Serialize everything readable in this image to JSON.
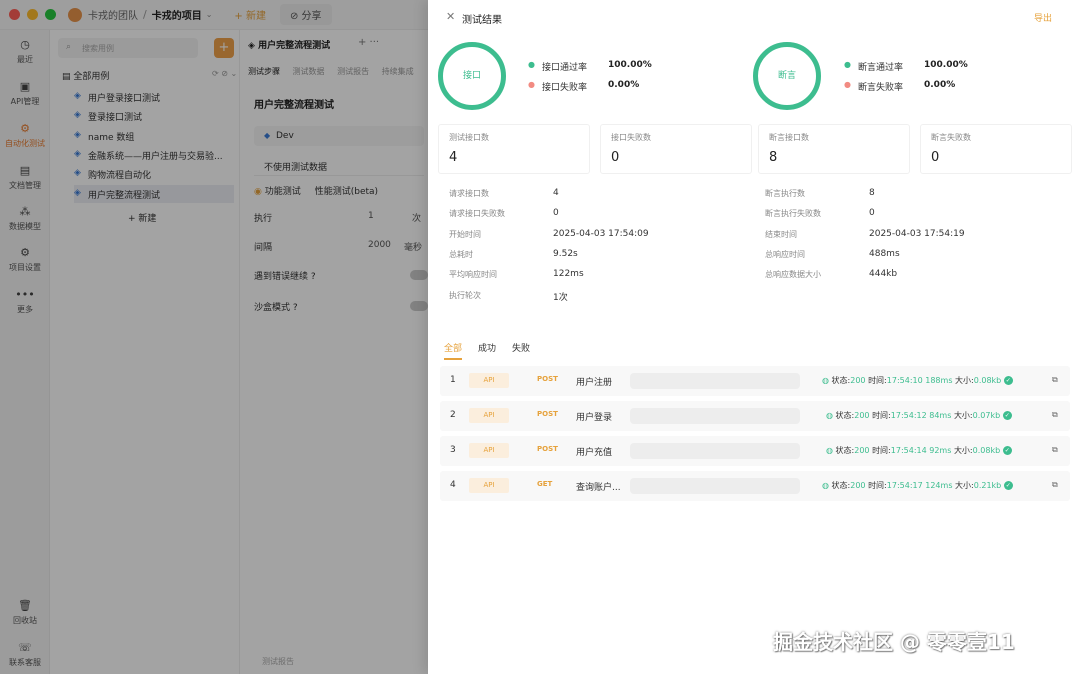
{
  "titlebar": {
    "team": "卡戎的团队",
    "project": "卡戎的项目",
    "new_label": "+ 新建",
    "share_label": "分享"
  },
  "sidebar": {
    "items": [
      {
        "label": "最近",
        "icon": "clock-icon",
        "glyph": "◷"
      },
      {
        "label": "API管理",
        "icon": "api-icon",
        "glyph": "▣"
      },
      {
        "label": "自动化测试",
        "icon": "automation-icon",
        "glyph": "⚙"
      },
      {
        "label": "文档管理",
        "icon": "document-icon",
        "glyph": "▤"
      },
      {
        "label": "数据模型",
        "icon": "data-model-icon",
        "glyph": "⁂"
      },
      {
        "label": "项目设置",
        "icon": "settings-icon",
        "glyph": "⚙"
      },
      {
        "label": "更多",
        "icon": "more-icon",
        "glyph": "•••"
      }
    ],
    "bottom": [
      {
        "label": "回收站",
        "icon": "trash-icon",
        "glyph": "🗑"
      },
      {
        "label": "联系客服",
        "icon": "support-icon",
        "glyph": "☏"
      }
    ]
  },
  "tree": {
    "search_placeholder": "搜索用例",
    "add": "+",
    "header": "全部用例",
    "items": [
      "用户登录接口测试",
      "登录接口测试",
      "name 数组",
      "金融系统——用户注册与交易验...",
      "购物流程自动化",
      "用户完整流程测试"
    ],
    "new_label": "+ 新建"
  },
  "center": {
    "tab_title": "用户完整流程测试",
    "tab_ctrl": "+  ···",
    "subtabs": [
      "测试步骤",
      "测试数据",
      "测试报告",
      "持续集成"
    ],
    "heading": "用户完整流程测试",
    "env": "Dev",
    "data_mode": "不使用测试数据",
    "mode1": "功能测试",
    "mode2": "性能测试(beta)",
    "rows": [
      {
        "label": "执行",
        "value": "1",
        "unit": "次"
      },
      {
        "label": "间隔",
        "value": "2000",
        "unit": "毫秒"
      }
    ],
    "toggle1": "遇到错误继续",
    "toggle2": "沙盒模式",
    "report": "测试报告"
  },
  "drawer": {
    "title": "测试结果",
    "export": "导出",
    "api_ring": "接口",
    "assert_ring": "断言",
    "api_pass_label": "接口通过率",
    "api_pass_value": "100.00%",
    "api_fail_label": "接口失败率",
    "api_fail_value": "0.00%",
    "assert_pass_label": "断言通过率",
    "assert_pass_value": "100.00%",
    "assert_fail_label": "断言失败率",
    "assert_fail_value": "0.00%",
    "cards": [
      {
        "label": "测试接口数",
        "value": "4"
      },
      {
        "label": "接口失败数",
        "value": "0"
      },
      {
        "label": "断言接口数",
        "value": "8"
      },
      {
        "label": "断言失败数",
        "value": "0"
      }
    ],
    "left_kv": [
      {
        "k": "请求接口数",
        "v": "4"
      },
      {
        "k": "请求接口失败数",
        "v": "0"
      },
      {
        "k": "开始时间",
        "v": "2025-04-03 17:54:09"
      },
      {
        "k": "总耗时",
        "v": "9.52s"
      },
      {
        "k": "平均响应时间",
        "v": "122ms"
      },
      {
        "k": "执行轮次",
        "v": "1次"
      }
    ],
    "right_kv": [
      {
        "k": "断言执行数",
        "v": "8"
      },
      {
        "k": "断言执行失败数",
        "v": "0"
      },
      {
        "k": "结束时间",
        "v": "2025-04-03 17:54:19"
      },
      {
        "k": "总响应时间",
        "v": "488ms"
      },
      {
        "k": "总响应数据大小",
        "v": "444kb"
      }
    ],
    "tabs": [
      "全部",
      "成功",
      "失败"
    ],
    "requests": [
      {
        "num": "1",
        "tag": "API",
        "method": "POST",
        "name": "用户注册",
        "status_label": "状态:",
        "status": "200",
        "time_label": "时间:",
        "time": "17:54:10",
        "ms": "188ms",
        "size_label": "大小:",
        "size": "0.08kb"
      },
      {
        "num": "2",
        "tag": "API",
        "method": "POST",
        "name": "用户登录",
        "status_label": "状态:",
        "status": "200",
        "time_label": "时间:",
        "time": "17:54:12",
        "ms": "84ms",
        "size_label": "大小:",
        "size": "0.07kb"
      },
      {
        "num": "3",
        "tag": "API",
        "method": "POST",
        "name": "用户充值",
        "status_label": "状态:",
        "status": "200",
        "time_label": "时间:",
        "time": "17:54:14",
        "ms": "92ms",
        "size_label": "大小:",
        "size": "0.08kb"
      },
      {
        "num": "4",
        "tag": "API",
        "method": "GET",
        "name": "查询账户...",
        "status_label": "状态:",
        "status": "200",
        "time_label": "时间:",
        "time": "17:54:17",
        "ms": "124ms",
        "size_label": "大小:",
        "size": "0.21kb"
      }
    ]
  },
  "watermark": "掘金技术社区 @ 零零壹11",
  "colors": {
    "accent": "#e6a23c",
    "success": "#3dbd8f",
    "fail": "#f28b82"
  }
}
